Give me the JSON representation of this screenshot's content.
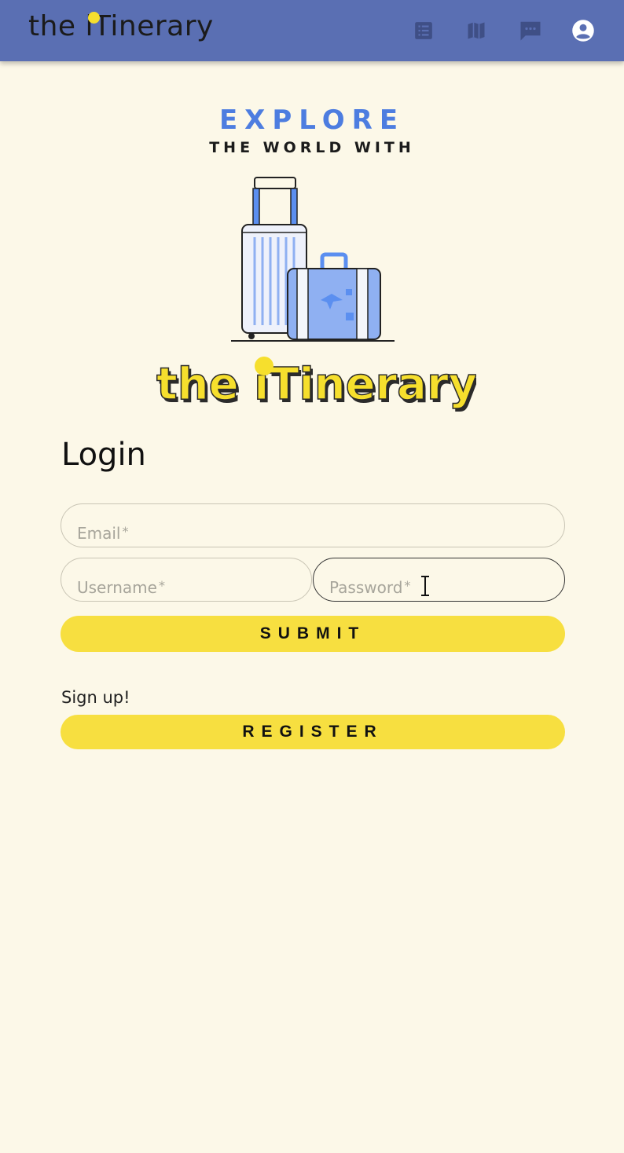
{
  "appbar": {
    "brand": "the iTinerary",
    "bg_color": "#5a6fb3",
    "icons": [
      "list-icon",
      "map-icon",
      "chat-icon",
      "account-icon"
    ]
  },
  "hero": {
    "line1": "EXPLORE",
    "line2": "THE WORLD WITH",
    "logo_text": "the iTinerary",
    "accent": "#4d7de0",
    "logo_color": "#f6df2d"
  },
  "login": {
    "title": "Login",
    "email_label": "Email",
    "username_label": "Username",
    "password_label": "Password",
    "required_mark": "*",
    "submit_label": "SUBMIT",
    "signup_text": "Sign up!",
    "register_label": "REGISTER",
    "button_color": "#f7df40"
  }
}
